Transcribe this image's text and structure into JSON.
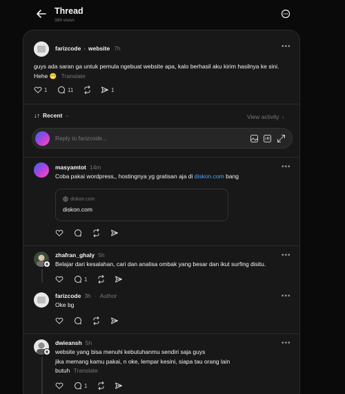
{
  "header": {
    "title": "Thread",
    "views": "389 views"
  },
  "post": {
    "author": "farizcode",
    "community": "website",
    "time": "7h",
    "text": "guys ada saran ga untuk pemula ngebuat website apa, kalo berhasil aku kirim hasilnya ke sini. Hehe 😁",
    "translate": "Translate",
    "likes": "1",
    "replies": "11",
    "shares": "1"
  },
  "sort": {
    "label": "Recent",
    "view_activity": "View activity"
  },
  "reply_box": {
    "placeholder": "Reply to farizcode..."
  },
  "comments": [
    {
      "author": "masyamtot",
      "time": "14m",
      "text_before": "Coba pakai wordpress,, hostingnya yg gratisan aja di ",
      "link": "diskon.com",
      "text_after": " bang",
      "preview_domain": "diskon.com",
      "preview_title": "diskon.com"
    },
    {
      "author": "zhafran_ghaly",
      "time": "5h",
      "text": "Belajar dari kesalahan, cari dan analisa ombak yang besar dan ikut surfing disitu.",
      "replies": "1"
    },
    {
      "author": "farizcode",
      "time": "3h",
      "badge": "Author",
      "text": "Oke bg"
    },
    {
      "author": "dwieansh",
      "time": "5h",
      "line1": "website yang bisa menuhi kebutuhanmu sendiri saja guys",
      "line2": "jika memang kamu pakai, n oke, lempar kesini, siapa tau orang lain",
      "line3": "butuh",
      "translate": "Translate",
      "replies": "1"
    }
  ],
  "colors": {
    "bg": "#0a0a0a",
    "card": "#181818",
    "link": "#4aa6ff",
    "muted": "#777777"
  }
}
